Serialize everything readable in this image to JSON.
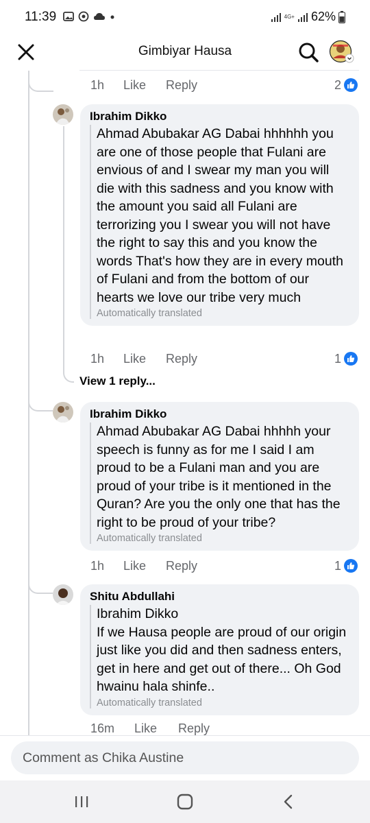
{
  "status": {
    "time": "11:39",
    "network": "4G+",
    "battery": "62%"
  },
  "header": {
    "title": "Gimbiyar Hausa"
  },
  "top_actions": {
    "time": "1h",
    "like": "Like",
    "reply": "Reply",
    "reactions": "2"
  },
  "comments": [
    {
      "author": "Ibrahim Dikko",
      "text": "Ahmad Abubakar AG Dabai hhhhhh you are one of those people that Fulani are envious of and I swear my man you will die with this sadness and you know with the amount you said all Fulani are terrorizing you I swear you will not have the right to say this and you know the words That's how they are in every mouth of Fulani and from the bottom of our hearts we love our tribe very much",
      "translated": "Automatically translated",
      "time": "1h",
      "like": "Like",
      "reply": "Reply",
      "reactions": "1"
    },
    {
      "author": "Ibrahim Dikko",
      "text": "Ahmad Abubakar AG Dabai hhhhh your speech is funny as for me I said I am proud to be a Fulani man and you are proud of your tribe is it mentioned in the Quran? Are you the only one that has the right to be proud of your tribe?",
      "translated": "Automatically translated",
      "time": "1h",
      "like": "Like",
      "reply": "Reply",
      "reactions": "1"
    },
    {
      "author": "Shitu Abdullahi",
      "mention": "Ibrahim Dikko",
      "text": "If we Hausa people are proud of our origin just like you did and then sadness enters, get in here and get out of there... Oh God hwainu hala shinfe..",
      "translated": "Automatically translated",
      "time": "16m",
      "like": "Like",
      "reply": "Reply"
    }
  ],
  "view_replies": "View 1 reply...",
  "composer": {
    "placeholder": "Comment as Chika Austine"
  },
  "colors": {
    "accent": "#1877f2",
    "bubble": "#f0f2f5",
    "muted": "#65676b"
  },
  "icons": [
    "close-icon",
    "search-icon",
    "like-reaction-icon",
    "recent-apps-icon",
    "home-icon",
    "back-icon"
  ]
}
